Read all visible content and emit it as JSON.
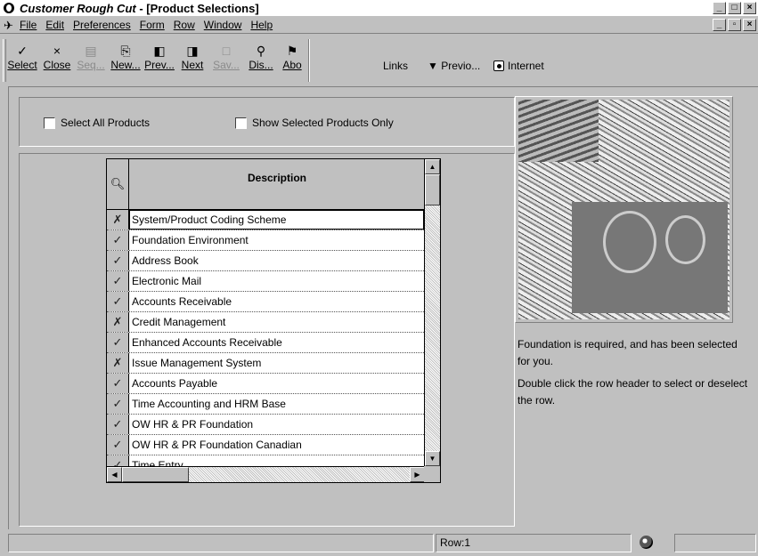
{
  "window": {
    "title_app": "Customer Rough Cut",
    "title_form": " - [Product Selections]",
    "buttons": [
      "_",
      "□",
      "×"
    ]
  },
  "menu": {
    "items": [
      "File",
      "Edit",
      "Preferences",
      "Form",
      "Row",
      "Window",
      "Help"
    ],
    "child_buttons": [
      "_",
      "▫",
      "×"
    ]
  },
  "toolbar": {
    "buttons": [
      {
        "label": "Select",
        "icon": "✓",
        "enabled": true
      },
      {
        "label": "Close",
        "icon": "×",
        "enabled": true
      },
      {
        "label": "Seq...",
        "icon": "▤",
        "enabled": false
      },
      {
        "label": "New...",
        "icon": "⎘",
        "enabled": true
      },
      {
        "label": "Prev...",
        "icon": "◧",
        "enabled": true
      },
      {
        "label": "Next",
        "icon": "◨",
        "enabled": true
      },
      {
        "label": "Sav...",
        "icon": "□",
        "enabled": false
      },
      {
        "label": "Dis...",
        "icon": "⚲",
        "enabled": true
      },
      {
        "label": "Abo",
        "icon": "⚑",
        "enabled": true
      }
    ],
    "links": "Links",
    "previo": "Previo...",
    "internet": "Internet"
  },
  "options": {
    "select_all": "Select All Products",
    "show_selected": "Show Selected Products Only"
  },
  "grid": {
    "header_icon": "search-icon",
    "column": "Description",
    "rows": [
      {
        "mark": "✗",
        "text": "System/Product Coding Scheme"
      },
      {
        "mark": "✓",
        "text": "Foundation Environment"
      },
      {
        "mark": "✓",
        "text": "Address Book"
      },
      {
        "mark": "✓",
        "text": "Electronic Mail"
      },
      {
        "mark": "✓",
        "text": "Accounts Receivable"
      },
      {
        "mark": "✗",
        "text": "Credit Management"
      },
      {
        "mark": "✓",
        "text": "Enhanced Accounts Receivable"
      },
      {
        "mark": "✗",
        "text": "Issue Management System"
      },
      {
        "mark": "✓",
        "text": "Accounts Payable"
      },
      {
        "mark": "✓",
        "text": "Time Accounting and HRM Base"
      },
      {
        "mark": "✓",
        "text": "OW HR & PR Foundation"
      },
      {
        "mark": "✓",
        "text": "OW HR & PR Foundation Canadian"
      },
      {
        "mark": "✓",
        "text": "Time Entry"
      }
    ]
  },
  "info": {
    "line1": "Foundation is required, and has been selected for you.",
    "line2": "Double click the row header to select or deselect the row."
  },
  "status": {
    "row": "Row:1"
  }
}
